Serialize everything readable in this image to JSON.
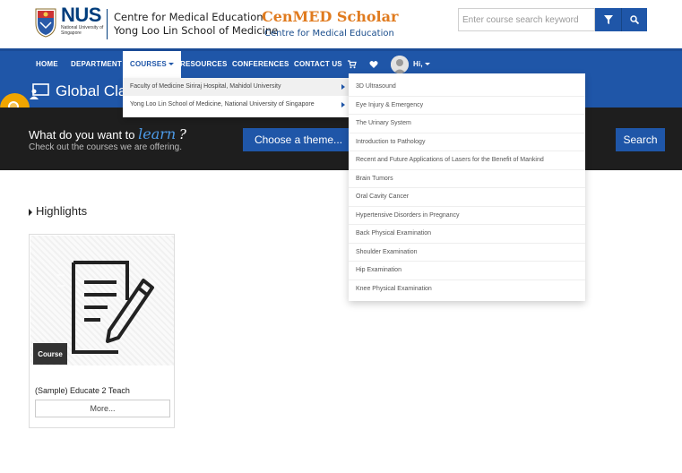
{
  "header": {
    "nus_name": "NUS",
    "nus_subtitle": "National University of Singapore",
    "cme_line1": "Centre for Medical Education",
    "cme_line2": "Yong Loo Lin School of Medicine",
    "cenmed_title": "CenMED Scholar",
    "cenmed_subtitle": "Centre for Medical Education",
    "search_placeholder": "Enter course search keyword",
    "colors": {
      "primary": "#1f56a8",
      "orange": "#e07b1f",
      "dark": "#1e1e1e"
    }
  },
  "nav": {
    "items": [
      "HOME",
      "DEPARTMENT",
      "COURSES",
      "RESOURCES",
      "CONFERENCES",
      "CONTACT US"
    ],
    "user_greeting": "Hi,"
  },
  "banner": {
    "title": "Global Clas"
  },
  "hero": {
    "prompt_prefix": "What do you want to",
    "prompt_word": "learn",
    "prompt_mark": "?",
    "subtext": "Check out the courses we are offering.",
    "theme_button": "Choose a theme...",
    "search_button": "Search"
  },
  "highlights": {
    "heading": "Highlights",
    "card": {
      "badge": "Course",
      "title": "(Sample) Educate 2 Teach",
      "more_button": "More..."
    }
  },
  "courses_menu": {
    "items": [
      "Faculty of Medicine Siriraj Hospital, Mahidol University",
      "Yong Loo Lin School of Medicine, National University of Singapore"
    ],
    "submenu": [
      "3D Ultrasound",
      "Eye Injury & Emergency",
      "The Urinary System",
      "Introduction to Pathology",
      "Recent and Future Applications of Lasers for the Benefit of Mankind",
      "Brain Tumors",
      "Oral Cavity Cancer",
      "Hypertensive Disorders in Pregnancy",
      "Back Physical Examination",
      "Shoulder Examination",
      "Hip Examination",
      "Knee Physical Examination"
    ]
  }
}
